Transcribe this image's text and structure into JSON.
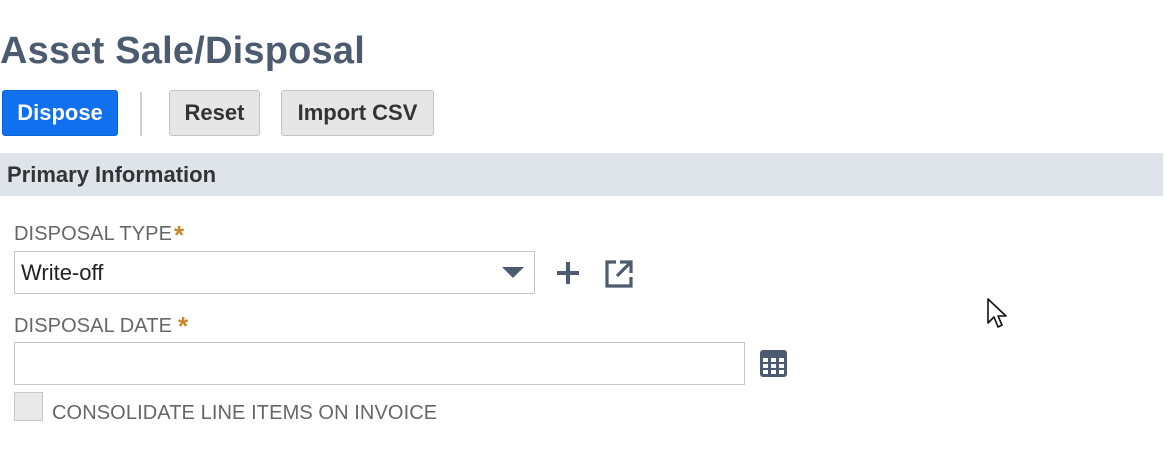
{
  "page": {
    "title": "Asset Sale/Disposal"
  },
  "toolbar": {
    "dispose_label": "Dispose",
    "reset_label": "Reset",
    "import_label": "Import CSV"
  },
  "section": {
    "title": "Primary Information"
  },
  "fields": {
    "disposal_type": {
      "label": "DISPOSAL TYPE",
      "required_mark": "*",
      "value": "Write-off",
      "icons": [
        "plus-icon",
        "open-external-icon",
        "chevron-down-icon"
      ]
    },
    "disposal_date": {
      "label": "DISPOSAL DATE",
      "required_mark": "*",
      "value": "",
      "icons": [
        "calendar-icon"
      ]
    },
    "consolidate": {
      "label": "CONSOLIDATE LINE ITEMS ON INVOICE",
      "checked": false
    }
  },
  "colors": {
    "title": "#4d5b71",
    "primary_button": "#1070f0",
    "section_header_bg": "#dfe4eb",
    "required_mark": "#c6862b",
    "icon": "#4d5b71"
  }
}
